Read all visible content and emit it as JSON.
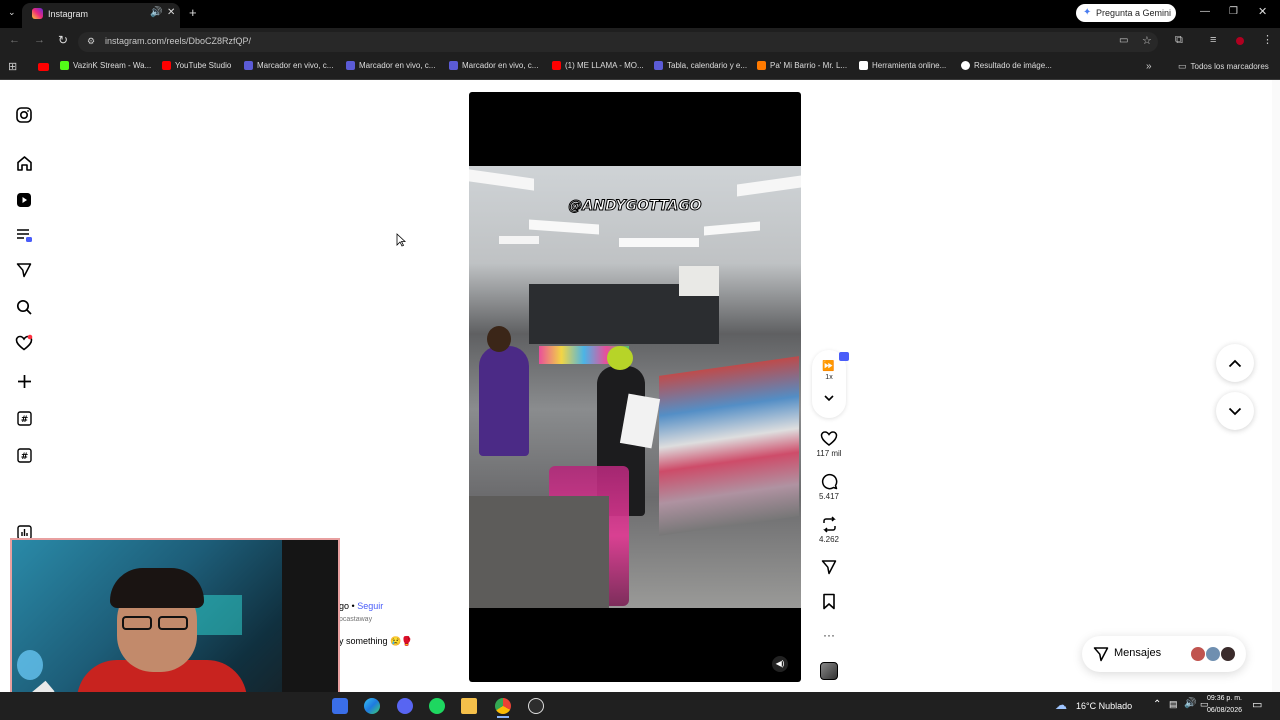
{
  "browser": {
    "tab_title": "Instagram",
    "gemini_button": "Pregunta a Gemini",
    "url": "instagram.com/reels/DboCZ8RzfQP/",
    "bookmarks": [
      "VazinK Stream - Wa...",
      "YouTube Studio",
      "Marcador en vivo, c...",
      "Marcador en vivo, c...",
      "Marcador en vivo, c...",
      "(1) ME LLAMA - MO...",
      "Tabla, calendario y e...",
      "Pa' Mi Barrio - Mr. L...",
      "Herramienta online...",
      "Resultado de imáge..."
    ],
    "all_bookmarks": "Todos los marcadores"
  },
  "reel": {
    "watermark": "@ANDYGOTTAGO",
    "speed": "1x",
    "likes": "117 mil",
    "comments": "5.417",
    "reposts": "4.262",
    "author_partial": "go",
    "separator": "•",
    "follow": "Seguir",
    "audio_partial": "pcastaway",
    "caption_partial": "y something 😢🥊"
  },
  "messages": {
    "label": "Mensajes"
  },
  "taskbar": {
    "weather": "16°C  Nublado",
    "time": "09:36 p. m.",
    "date": "06/08/2026"
  },
  "colors": {
    "accent_blue": "#4a5df9",
    "notification_red": "#ff3040",
    "chrome_dark": "#1f1f1f"
  }
}
